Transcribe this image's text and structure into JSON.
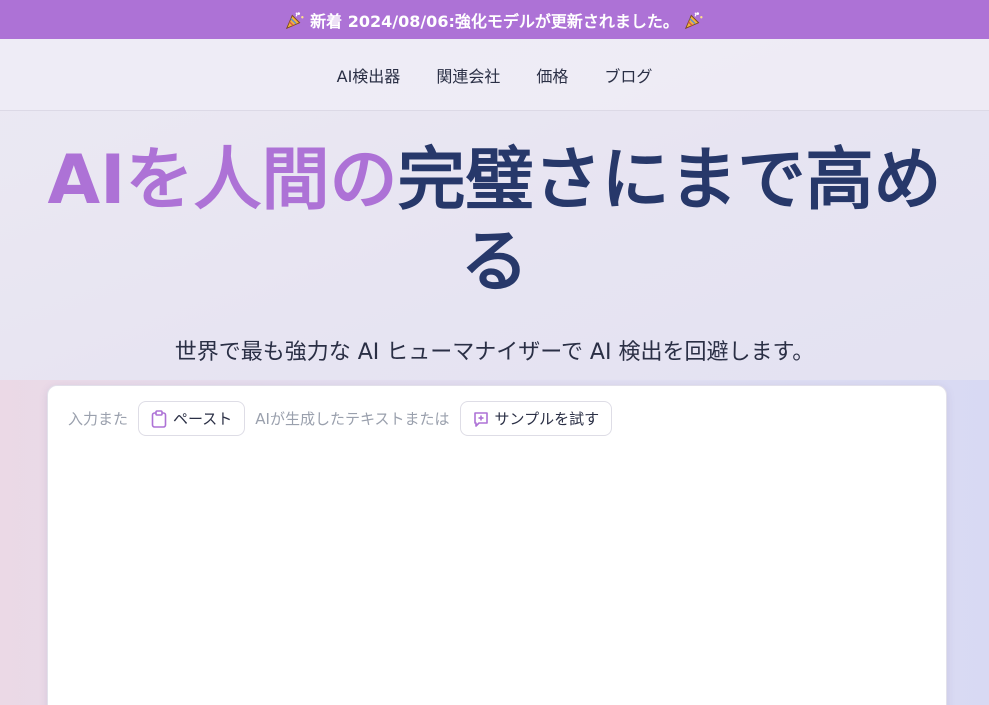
{
  "announcement": {
    "text": "新着 2024/08/06:強化モデルが更新されました。",
    "icon": "party-popper-icon"
  },
  "nav": {
    "items": [
      {
        "label": "AI検出器"
      },
      {
        "label": "関連会社"
      },
      {
        "label": "価格"
      },
      {
        "label": "ブログ"
      }
    ]
  },
  "hero": {
    "title_accent": "AIを人間の",
    "title_rest": "完璧さにまで高める",
    "subtitle": "世界で最も強力な AI ヒューマナイザーで AI 検出を回避します。"
  },
  "editor": {
    "prefix_text": "入力また",
    "paste_label": "ペースト",
    "middle_text": "AIが生成したテキストまたは",
    "sample_label": "サンプルを試す",
    "value": ""
  },
  "colors": {
    "accent": "#ad72d6",
    "title": "#27386a",
    "announce_bg": "#ad72d6"
  }
}
